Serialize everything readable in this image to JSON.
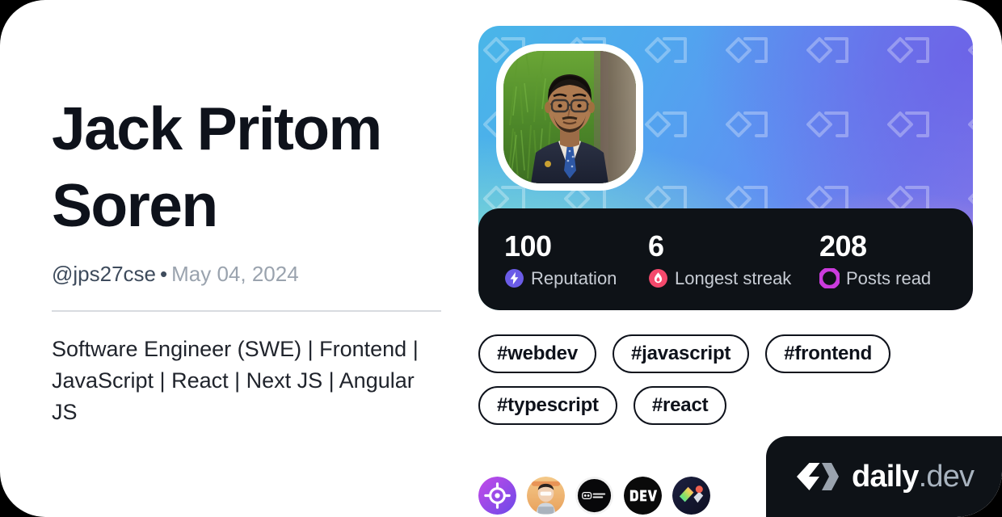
{
  "profile": {
    "display_name": "Jack Pritom Soren",
    "handle": "@jps27cse",
    "separator": "•",
    "joined_date": "May 04, 2024",
    "bio": "Software Engineer (SWE) | Frontend | JavaScript | React | Next JS | Angular JS",
    "avatar_alt": "profile-photo"
  },
  "stats": [
    {
      "value": "100",
      "label": "Reputation",
      "icon": "reputation-bolt-icon",
      "color": "#6b5ce7"
    },
    {
      "value": "6",
      "label": "Longest streak",
      "icon": "streak-flame-icon",
      "color": "#f4496c"
    },
    {
      "value": "208",
      "label": "Posts read",
      "icon": "posts-read-ring-icon",
      "color": "#cb3bdd"
    }
  ],
  "tags": [
    "#webdev",
    "#javascript",
    "#frontend",
    "#typescript",
    "#react"
  ],
  "sources": [
    {
      "name": "source-target",
      "title": "target-crosshair"
    },
    {
      "name": "source-avatar",
      "title": "developer-avatar"
    },
    {
      "name": "source-backend-dev",
      "title": "back-end developer"
    },
    {
      "name": "source-devto",
      "title": "DEV"
    },
    {
      "name": "source-shapes",
      "title": "colorful-shapes"
    }
  ],
  "brand": {
    "name": "daily",
    "suffix": ".dev",
    "mark": "daily-dev-logo-icon"
  },
  "colors": {
    "card_background": "#ffffff",
    "text_primary": "#0e121b",
    "text_secondary": "#3e4b5c",
    "text_muted": "#9aa3ae",
    "dark_panel": "#0e1217",
    "divider": "#d8dbe0"
  }
}
